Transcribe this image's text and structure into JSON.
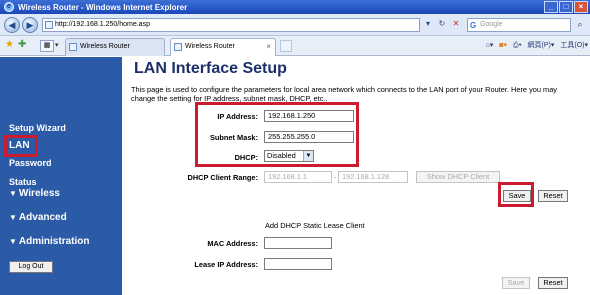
{
  "window": {
    "title": "Wireless Router - Windows Internet Explorer"
  },
  "browser": {
    "address": "http://192.168.1.250/home.asp",
    "search_placeholder": "Google",
    "tabs": [
      {
        "label": "Wireless Router",
        "active": false
      },
      {
        "label": "Wireless Router",
        "active": true
      }
    ],
    "tools": {
      "page_label": "網頁(P)",
      "tools_label": "工具(O)"
    }
  },
  "sidebar": {
    "items": [
      {
        "label": "Setup Wizard"
      },
      {
        "label": "LAN"
      },
      {
        "label": "Password"
      },
      {
        "label": "Status"
      },
      {
        "label": "Wireless"
      },
      {
        "label": "Advanced"
      },
      {
        "label": "Administration"
      }
    ],
    "logout_label": "Log Out"
  },
  "main": {
    "title": "LAN Interface Setup",
    "description": "This page is used to configure the parameters for local area network which connects to the LAN port of your Router. Here you may change the setting for IP address, subnet mask, DHCP, etc..",
    "ip_label": "IP Address:",
    "ip_value": "192.168.1.250",
    "mask_label": "Subnet Mask:",
    "mask_value": "255.255.255.0",
    "dhcp_label": "DHCP:",
    "dhcp_value": "Disabled",
    "range_label": "DHCP Client Range:",
    "range_start": "192.168.1.1",
    "range_sep": "-",
    "range_end": "192.168.1.128",
    "show_dhcp_label": "Show DHCP Client",
    "save_label": "Save",
    "reset_label": "Reset",
    "static_title": "Add DHCP Static Lease Client",
    "mac_label": "MAC Address:",
    "lease_ip_label": "Lease IP Address:",
    "save2_label": "Save",
    "reset2_label": "Reset"
  },
  "colors": {
    "sidebar_bg": "#2b5aa6",
    "heading": "#1b2f6b",
    "highlight": "#cc1a2e"
  }
}
